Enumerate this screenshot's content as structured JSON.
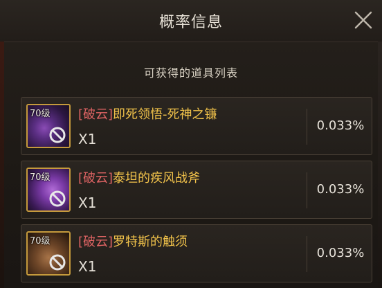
{
  "dialog": {
    "title": "概率信息",
    "subtitle": "可获得的道具列表"
  },
  "items": [
    {
      "level": "70级",
      "prefix": "[破云]",
      "name": "即死领悟-死神之镰",
      "quantity": "X1",
      "rate": "0.033%"
    },
    {
      "level": "70级",
      "prefix": "[破云]",
      "name": "泰坦的疾风战斧",
      "quantity": "X1",
      "rate": "0.033%"
    },
    {
      "level": "70级",
      "prefix": "[破云]",
      "name": "罗特斯的触须",
      "quantity": "X1",
      "rate": "0.033%"
    }
  ],
  "colors": {
    "item_name": "#f1c24a",
    "prefix": "#e06464",
    "icon_border": "#c59a3c"
  },
  "icons": {
    "close": "close-icon",
    "unusable": "ban-icon"
  }
}
